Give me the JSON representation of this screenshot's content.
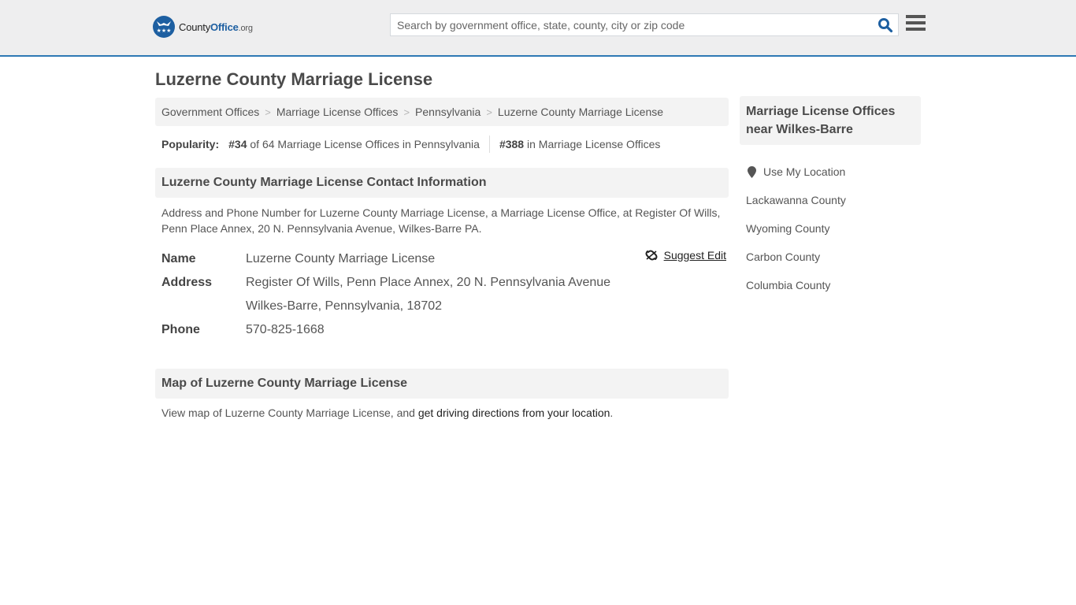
{
  "header": {
    "logo": {
      "county": "County",
      "office": "Office",
      "org": ".org"
    },
    "search": {
      "placeholder": "Search by government office, state, county, city or zip code",
      "value": ""
    },
    "colors": {
      "accent": "#2e78b4",
      "brand": "#1d5fa1",
      "topbar_bg": "#eeeeef"
    }
  },
  "page": {
    "title": "Luzerne County Marriage License"
  },
  "breadcrumb": [
    {
      "label": "Government Offices"
    },
    {
      "label": "Marriage License Offices"
    },
    {
      "label": "Pennsylvania"
    },
    {
      "label": "Luzerne County Marriage License"
    }
  ],
  "popularity": {
    "label": "Popularity:",
    "state_rank": "#34",
    "state_text": "of 64 Marriage License Offices in Pennsylvania",
    "national_rank": "#388",
    "national_text": "in Marriage License Offices"
  },
  "contact": {
    "heading": "Luzerne County Marriage License Contact Information",
    "description": "Address and Phone Number for Luzerne County Marriage License, a Marriage License Office, at Register Of Wills, Penn Place Annex, 20 N. Pennsylvania Avenue, Wilkes-Barre PA.",
    "suggest_edit": "Suggest Edit",
    "name_label": "Name",
    "name_value": "Luzerne County Marriage License",
    "address_label": "Address",
    "address_line1": "Register Of Wills, Penn Place Annex, 20 N. Pennsylvania Avenue",
    "address_line2": "Wilkes-Barre, Pennsylvania, 18702",
    "phone_label": "Phone",
    "phone_value": "570-825-1668"
  },
  "map": {
    "heading": "Map of Luzerne County Marriage License",
    "text_before": "View map of Luzerne County Marriage License, and ",
    "link": "get driving directions from your location",
    "text_after": "."
  },
  "sidebar": {
    "heading": "Marriage License Offices near Wilkes-Barre",
    "use_location": "Use My Location",
    "items": [
      {
        "label": "Lackawanna County"
      },
      {
        "label": "Wyoming County"
      },
      {
        "label": "Carbon County"
      },
      {
        "label": "Columbia County"
      }
    ]
  }
}
